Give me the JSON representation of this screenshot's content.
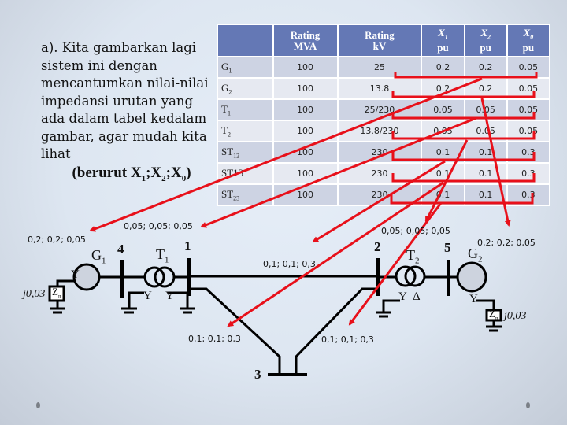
{
  "intro": {
    "lines": [
      "a). Kita gambarkan lagi",
      "sistem ini dengan",
      "mencantumkan nilai-nilai",
      "impedansi urutan yang",
      "ada dalam tabel kedalam",
      "gambar, agar mudah kita",
      "lihat"
    ],
    "emph_prefix": "(berurut ",
    "emph_x": "X",
    "emph_subs": [
      "1",
      "2",
      "0"
    ],
    "emph_sep": ";",
    "emph_suffix": ")"
  },
  "table": {
    "headers": [
      {
        "l1": "",
        "l2": ""
      },
      {
        "l1": "Rating",
        "l2": "MVA"
      },
      {
        "l1": "Rating",
        "l2": "kV"
      },
      {
        "l1": "X",
        "sub": "1",
        "l2": "pu"
      },
      {
        "l1": "X",
        "sub": "2",
        "l2": "pu"
      },
      {
        "l1": "X",
        "sub": "0",
        "l2": "pu"
      }
    ],
    "rows": [
      {
        "name": "G",
        "sub": "1",
        "mva": "100",
        "kv": "25",
        "x1": "0.2",
        "x2": "0.2",
        "x0": "0.05"
      },
      {
        "name": "G",
        "sub": "2",
        "mva": "100",
        "kv": "13.8",
        "x1": "0.2",
        "x2": "0.2",
        "x0": "0.05"
      },
      {
        "name": "T",
        "sub": "1",
        "mva": "100",
        "kv": "25/230",
        "x1": "0.05",
        "x2": "0.05",
        "x0": "0.05"
      },
      {
        "name": "T",
        "sub": "2",
        "mva": "100",
        "kv": "13.8/230",
        "x1": "0.05",
        "x2": "0.05",
        "x0": "0.05"
      },
      {
        "name": "ST",
        "sub": "12",
        "mva": "100",
        "kv": "230",
        "x1": "0.1",
        "x2": "0.1",
        "x0": "0.3"
      },
      {
        "name": "ST13",
        "sub": "",
        "mva": "100",
        "kv": "230",
        "x1": "0.1",
        "x2": "0.1",
        "x0": "0.3"
      },
      {
        "name": "ST",
        "sub": "23",
        "mva": "100",
        "kv": "230",
        "x1": "0.1",
        "x2": "0.1",
        "x0": "0.3"
      }
    ]
  },
  "diagram": {
    "buses": {
      "b1": "1",
      "b2": "2",
      "b3": "3",
      "b4": "4",
      "b5": "5"
    },
    "components": {
      "g1": {
        "name": "G",
        "sub": "1"
      },
      "g2": {
        "name": "G",
        "sub": "2"
      },
      "t1": {
        "name": "T",
        "sub": "1"
      },
      "t2": {
        "name": "T",
        "sub": "2"
      }
    },
    "values": {
      "g1": "0,2; 0,2; 0,05",
      "g2": "0,2; 0,2; 0,05",
      "t1": "0,05; 0,05; 0,05",
      "t2": "0,05; 0,05; 0,05",
      "line12": "0,1; 0,1; 0,3",
      "line13": "0,1; 0,1; 0,3",
      "line23": "0,1; 0,1; 0,3"
    },
    "connections": {
      "g1_y": "Y",
      "t1_left": "Y",
      "t1_right": "Y",
      "t2_left": "Y",
      "t2_right": "Δ",
      "g2_y": "Y"
    },
    "grounding": {
      "z_label": "Z",
      "z_sub": "n",
      "g1_impedance": "j0,03",
      "g2_impedance": "j0,03"
    },
    "annotation_color": "#e8101a"
  }
}
